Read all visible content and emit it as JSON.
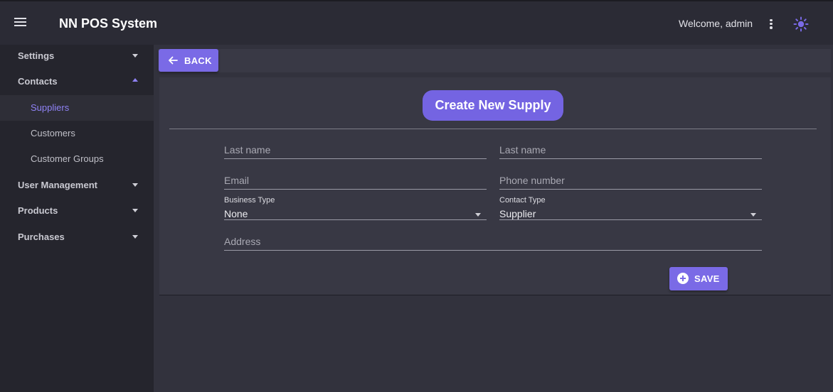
{
  "header": {
    "app_title": "NN POS System",
    "welcome": "Welcome, admin",
    "accent_color": "#7a6ae6"
  },
  "sidebar": {
    "items": [
      {
        "label": "Settings",
        "icon": "chevron-down-icon"
      },
      {
        "label": "Contacts",
        "icon": "chevron-up-icon",
        "expanded": true
      },
      {
        "label": "Suppliers",
        "active": true
      },
      {
        "label": "Customers"
      },
      {
        "label": "Customer Groups"
      },
      {
        "label": "User Management",
        "icon": "chevron-down-icon"
      },
      {
        "label": "Products",
        "icon": "chevron-down-icon"
      },
      {
        "label": "Purchases",
        "icon": "chevron-down-icon"
      }
    ]
  },
  "toolbar": {
    "back_label": "BACK"
  },
  "form": {
    "title": "Create New Supply",
    "first_name": {
      "placeholder": "Last name",
      "value": ""
    },
    "last_name": {
      "placeholder": "Last name",
      "value": ""
    },
    "email": {
      "placeholder": "Email",
      "value": ""
    },
    "phone": {
      "placeholder": "Phone number",
      "value": ""
    },
    "business_type": {
      "label": "Business Type",
      "value": "None"
    },
    "contact_type": {
      "label": "Contact Type",
      "value": "Supplier"
    },
    "address": {
      "placeholder": "Address",
      "value": ""
    },
    "save_label": "SAVE"
  }
}
